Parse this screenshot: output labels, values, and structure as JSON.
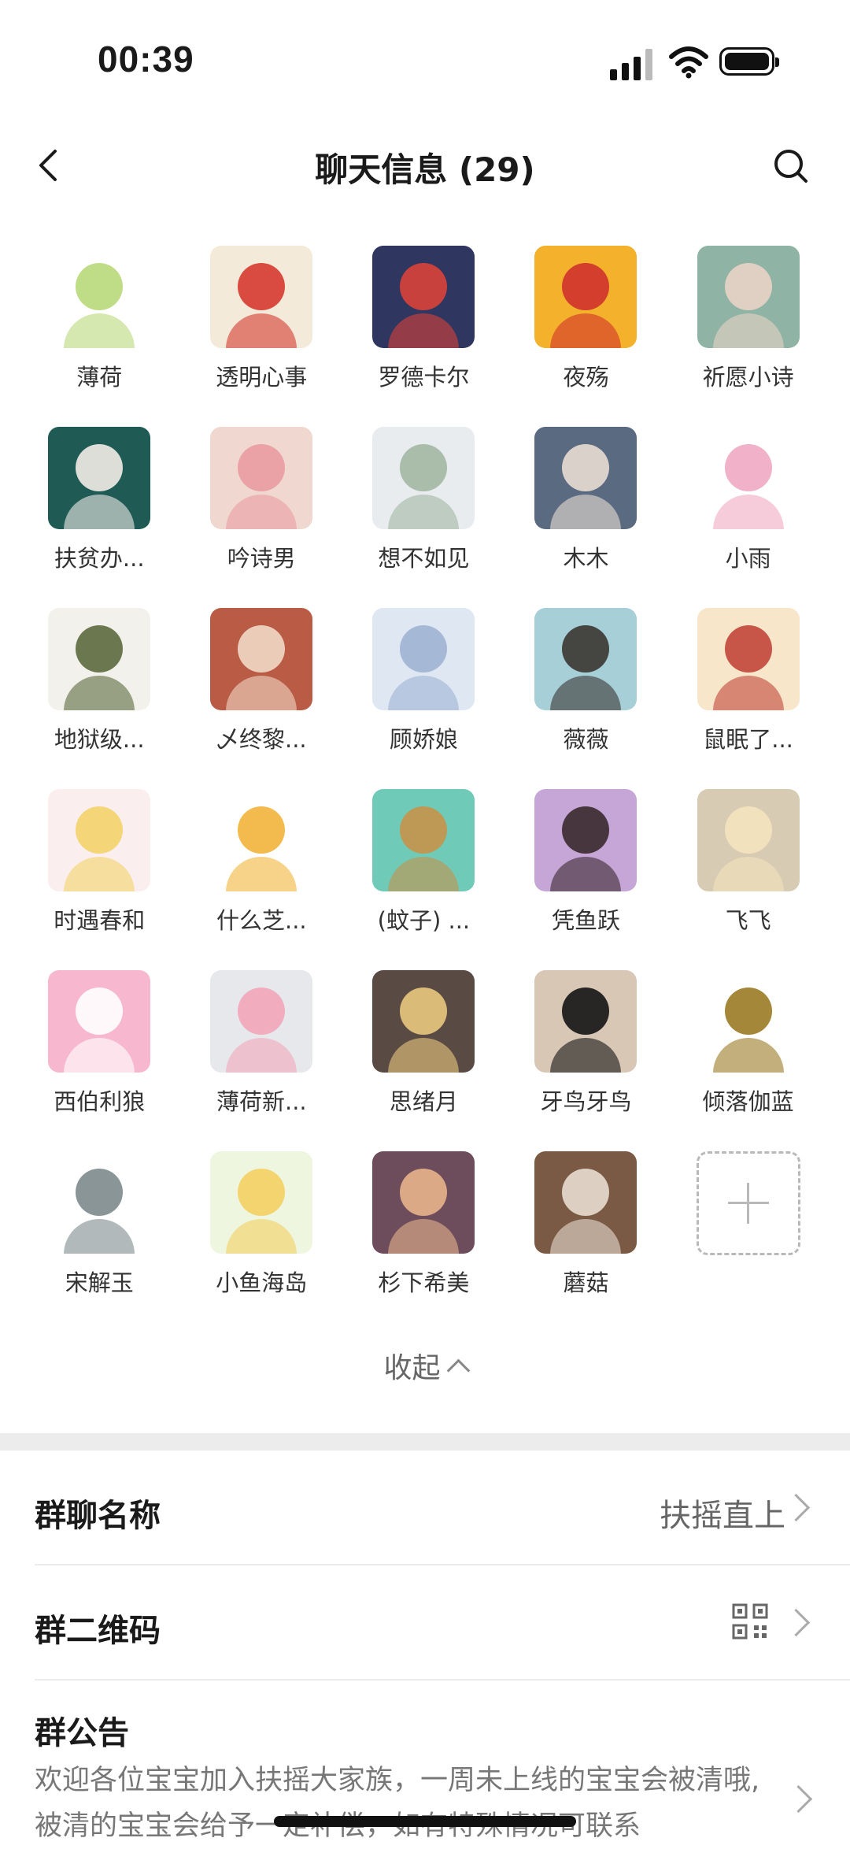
{
  "status": {
    "time": "00:39"
  },
  "header": {
    "title": "聊天信息 (29)"
  },
  "members": [
    {
      "name": "薄荷",
      "bg": "#ffffff",
      "fg": "#b8d87a"
    },
    {
      "name": "透明心事",
      "bg": "#f3ead9",
      "fg": "#d63a2f"
    },
    {
      "name": "罗德卡尔",
      "bg": "#2f3660",
      "fg": "#d9423a"
    },
    {
      "name": "夜殇",
      "bg": "#f4b12c",
      "fg": "#d0322c"
    },
    {
      "name": "祈愿小诗",
      "bg": "#8fb3a4",
      "fg": "#e8d3c6"
    },
    {
      "name": "扶贫办...",
      "bg": "#1f5a55",
      "fg": "#f1ece6"
    },
    {
      "name": "吟诗男",
      "bg": "#f0d8d0",
      "fg": "#e99ca2"
    },
    {
      "name": "想不如见",
      "bg": "#e8ecef",
      "fg": "#a3b7a2"
    },
    {
      "name": "木木",
      "bg": "#5a6a80",
      "fg": "#e9ddd3"
    },
    {
      "name": "小雨",
      "bg": "#ffffff",
      "fg": "#f0aac3"
    },
    {
      "name": "地狱级...",
      "bg": "#f3f1ec",
      "fg": "#5c6a3e"
    },
    {
      "name": "乄终黎...",
      "bg": "#b95b45",
      "fg": "#f0d8c4"
    },
    {
      "name": "顾娇娘",
      "bg": "#dfe7f2",
      "fg": "#9fb4d3"
    },
    {
      "name": "薇薇",
      "bg": "#a7cfd8",
      "fg": "#3b3632"
    },
    {
      "name": "鼠眠了...",
      "bg": "#f7e6c9",
      "fg": "#c2463a"
    },
    {
      "name": "时遇春和",
      "bg": "#fbeeee",
      "fg": "#f3d36a"
    },
    {
      "name": "什么芝...",
      "bg": "#ffffff",
      "fg": "#f2b43b"
    },
    {
      "name": "(蚊子) ...",
      "bg": "#6fcab8",
      "fg": "#c6934a"
    },
    {
      "name": "凭鱼跃",
      "bg": "#c6a6d6",
      "fg": "#3a2a2f"
    },
    {
      "name": "飞飞",
      "bg": "#d8cbb4",
      "fg": "#f4e3bd"
    },
    {
      "name": "西伯利狼",
      "bg": "#f7b8cf",
      "fg": "#ffffff"
    },
    {
      "name": "薄荷新...",
      "bg": "#e6e8ec",
      "fg": "#f2a6b9"
    },
    {
      "name": "思绪月",
      "bg": "#5a4a44",
      "fg": "#e9c87e"
    },
    {
      "name": "牙鸟牙鸟",
      "bg": "#d9c7b5",
      "fg": "#141414"
    },
    {
      "name": "倾落伽蓝",
      "bg": "#ffffff",
      "fg": "#9a7a24"
    },
    {
      "name": "宋解玉",
      "bg": "#ffffff",
      "fg": "#7d8a8c"
    },
    {
      "name": "小鱼海岛",
      "bg": "#eef6df",
      "fg": "#f4d063"
    },
    {
      "name": "杉下希美",
      "bg": "#6d4c5c",
      "fg": "#e8b48c"
    },
    {
      "name": "蘑菇",
      "bg": "#7a5a44",
      "fg": "#e8dcd0"
    }
  ],
  "collapse_label": "收起",
  "settings": {
    "group_name_label": "群聊名称",
    "group_name_value": "扶摇直上",
    "qr_label": "群二维码",
    "notice_label": "群公告",
    "notice_text": "欢迎各位宝宝加入扶摇大家族，一周未上线的宝宝会被清哦,被清的宝宝会给予一定补偿，如有特殊情况可联系"
  }
}
